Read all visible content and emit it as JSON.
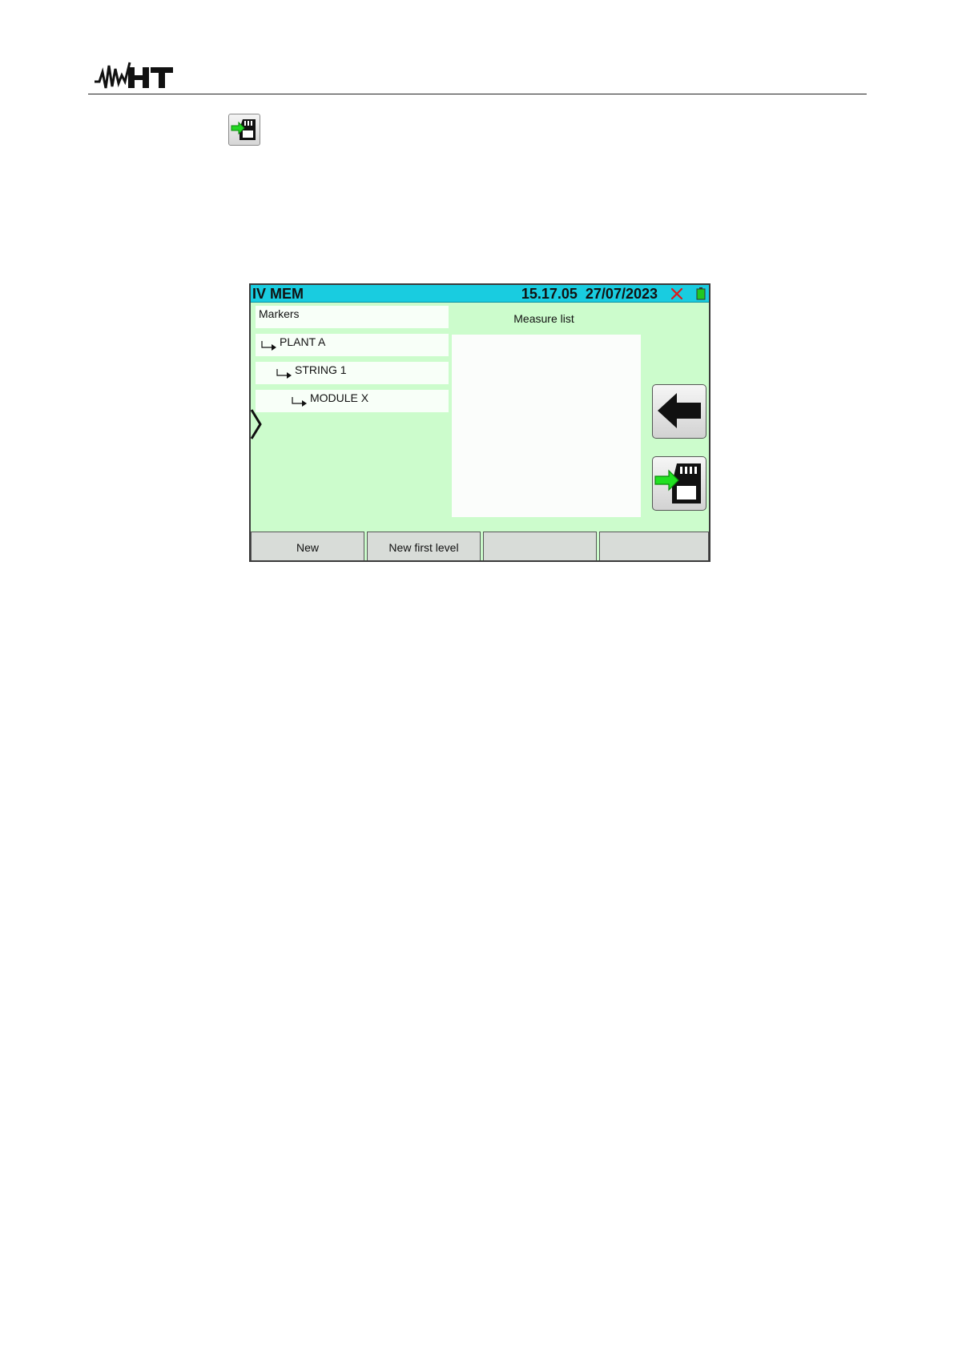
{
  "header": {
    "logo_text": "HT",
    "logo_icon": "ht-logo"
  },
  "inline_icon": "save-to-sd-icon",
  "screen": {
    "title": "IV MEM",
    "time": "15.17.05",
    "date": "27/07/2023",
    "status_icons": [
      "close-icon",
      "battery-icon"
    ],
    "background_color": "#ccfccc",
    "title_bar_color": "#19cce0",
    "tree": {
      "header": "Markers",
      "items": [
        {
          "label": "PLANT A",
          "level": 1
        },
        {
          "label": "STRING 1",
          "level": 2
        },
        {
          "label": "MODULE X",
          "level": 3
        }
      ]
    },
    "measure_list": {
      "title": "Measure list",
      "items": []
    },
    "side_buttons": [
      "back-arrow-icon",
      "save-to-sd-icon"
    ],
    "softkeys": [
      "New",
      "New first level",
      "",
      ""
    ]
  }
}
